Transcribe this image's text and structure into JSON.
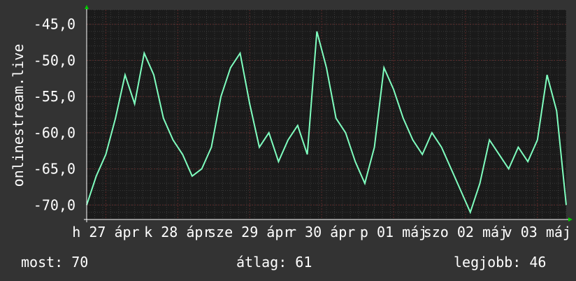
{
  "chart_data": {
    "type": "line",
    "ylabel": "onlinestream.live",
    "ylim": [
      -72,
      -43
    ],
    "yticks": [
      -45,
      -50,
      -55,
      -60,
      -65,
      -70
    ],
    "ytick_labels": [
      "-45,0",
      "-50,0",
      "-55,0",
      "-60,0",
      "-65,0",
      "-70,0"
    ],
    "xtick_labels": [
      "h 27 ápr",
      "k 28 ápr",
      "sze 29 ápr",
      "r 30 ápr",
      "p 01 máj",
      "szo 02 máj",
      "v 03 máj"
    ],
    "xtick_positions": [
      0.04,
      0.19,
      0.34,
      0.49,
      0.64,
      0.79,
      0.94
    ],
    "x": [
      0.0,
      0.02,
      0.04,
      0.06,
      0.08,
      0.1,
      0.12,
      0.14,
      0.16,
      0.18,
      0.2,
      0.22,
      0.24,
      0.26,
      0.28,
      0.3,
      0.32,
      0.34,
      0.36,
      0.38,
      0.4,
      0.42,
      0.44,
      0.46,
      0.48,
      0.5,
      0.52,
      0.54,
      0.56,
      0.58,
      0.6,
      0.62,
      0.64,
      0.66,
      0.68,
      0.7,
      0.72,
      0.74,
      0.76,
      0.78,
      0.8,
      0.82,
      0.84,
      0.86,
      0.88,
      0.9,
      0.92,
      0.94,
      0.96,
      0.98,
      1.0
    ],
    "series": [
      {
        "color": "#7fffbf",
        "values": [
          -70,
          -66,
          -63,
          -58,
          -52,
          -56,
          -49,
          -52,
          -58,
          -61,
          -63,
          -66,
          -65,
          -62,
          -55,
          -51,
          -49,
          -56,
          -62,
          -60,
          -64,
          -61,
          -59,
          -63,
          -46,
          -51,
          -58,
          -60,
          -64,
          -67,
          -62,
          -51,
          -54,
          -58,
          -61,
          -63,
          -60,
          -62,
          -65,
          -68,
          -71,
          -67,
          -61,
          -63,
          -65,
          -62,
          -64,
          -61,
          -52,
          -57,
          -70
        ]
      }
    ]
  },
  "legend": {
    "current": "most: 70",
    "average": "átlag: 61",
    "best": "legjobb: 46"
  }
}
